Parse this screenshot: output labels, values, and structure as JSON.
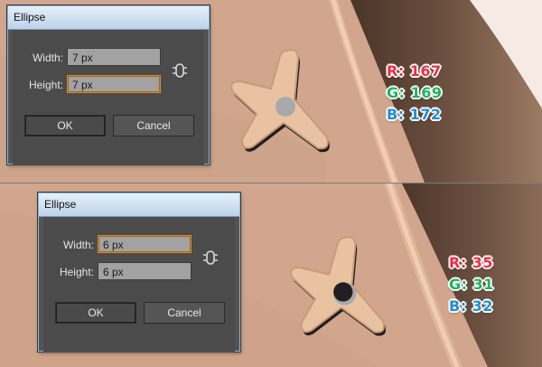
{
  "dialog_top": {
    "title": "Ellipse",
    "width_label": "Width:",
    "width_value": "7 px",
    "height_label": "Height:",
    "height_value": "7 px",
    "focused_field": "height",
    "ok_label": "OK",
    "cancel_label": "Cancel"
  },
  "dialog_bottom": {
    "title": "Ellipse",
    "width_label": "Width:",
    "width_value": "6 px",
    "height_label": "Height:",
    "height_value": "6 px",
    "focused_field": "width",
    "ok_label": "OK",
    "cancel_label": "Cancel"
  },
  "color_top": {
    "r_label": "R: 167",
    "g_label": "G: 169",
    "b_label": "B: 172",
    "fill": "#a7a9ac"
  },
  "color_bottom": {
    "r_label": "R: 35",
    "g_label": "G: 31",
    "b_label": "B: 32",
    "fill": "#231f20"
  },
  "colors": {
    "background": "#d1a68c",
    "leather_dark": "#4a3528",
    "leather_mid": "#8a6a56",
    "stitch": "#ecc7ae",
    "star_fill": "#e9c2a1",
    "star_outline": "#231f20",
    "red": "#ef2d43",
    "green": "#1db35a",
    "blue": "#1f8ed6"
  },
  "icons": {
    "constrain": "link-constrain-icon"
  }
}
